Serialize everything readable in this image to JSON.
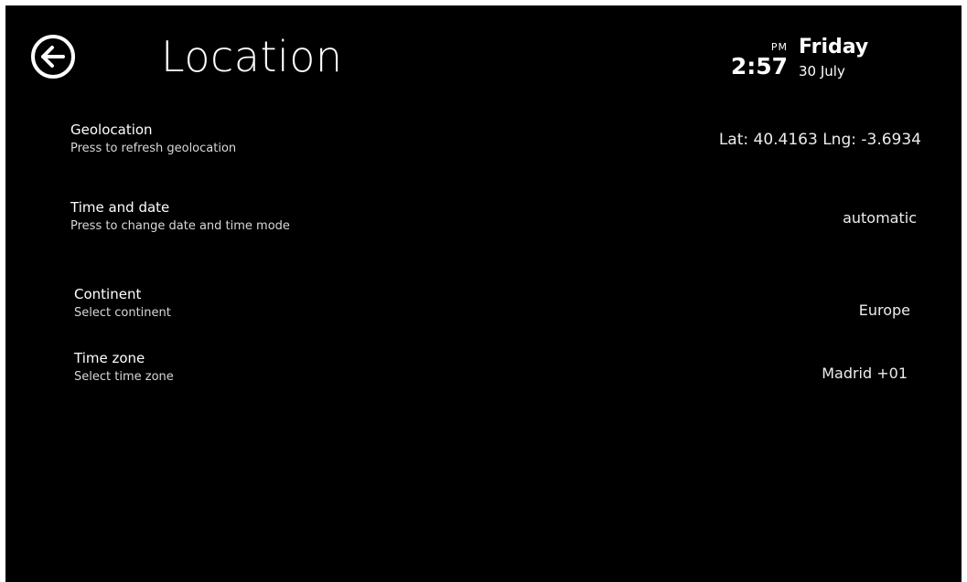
{
  "header": {
    "title": "Location",
    "back_icon": "arrow-left-circle-icon"
  },
  "clock": {
    "ampm": "PM",
    "time": "2:57",
    "day": "Friday",
    "date": "30 July"
  },
  "settings": [
    {
      "title": "Geolocation",
      "subtitle": "Press to refresh geolocation",
      "value": "Lat: 40.4163  Lng: -3.6934"
    },
    {
      "title": "Time and date",
      "subtitle": "Press to change date and time mode",
      "value": "automatic"
    },
    {
      "title": "Continent",
      "subtitle": "Select continent",
      "value": "Europe"
    },
    {
      "title": "Time zone",
      "subtitle": "Select time zone",
      "value": "Madrid +01"
    }
  ],
  "colors": {
    "background": "#000000",
    "text": "#ffffff"
  }
}
